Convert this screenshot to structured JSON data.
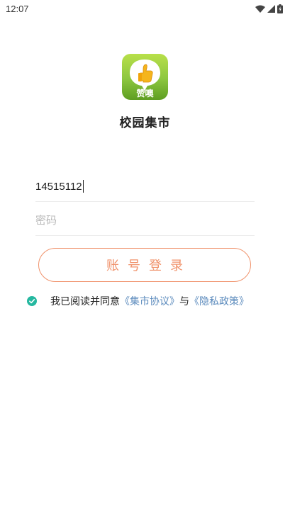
{
  "status_bar": {
    "time": "12:07",
    "icons": [
      "wifi-icon",
      "signal-icon",
      "battery-icon"
    ]
  },
  "app": {
    "name": "校园集市",
    "logo_text": "赞噢"
  },
  "form": {
    "account_value": "14515112",
    "password_placeholder": "密码",
    "login_button_label": "账号登录"
  },
  "agreement": {
    "checked": true,
    "text_prefix": "我已阅读并同意",
    "market_agreement_link": "《集市协议》",
    "conjunction": "与",
    "privacy_policy_link": "《隐私政策》"
  },
  "colors": {
    "accent": "#f0926b",
    "link": "#5c8bbd",
    "check": "#26b8a0",
    "logo_green": "#8cc63f"
  }
}
